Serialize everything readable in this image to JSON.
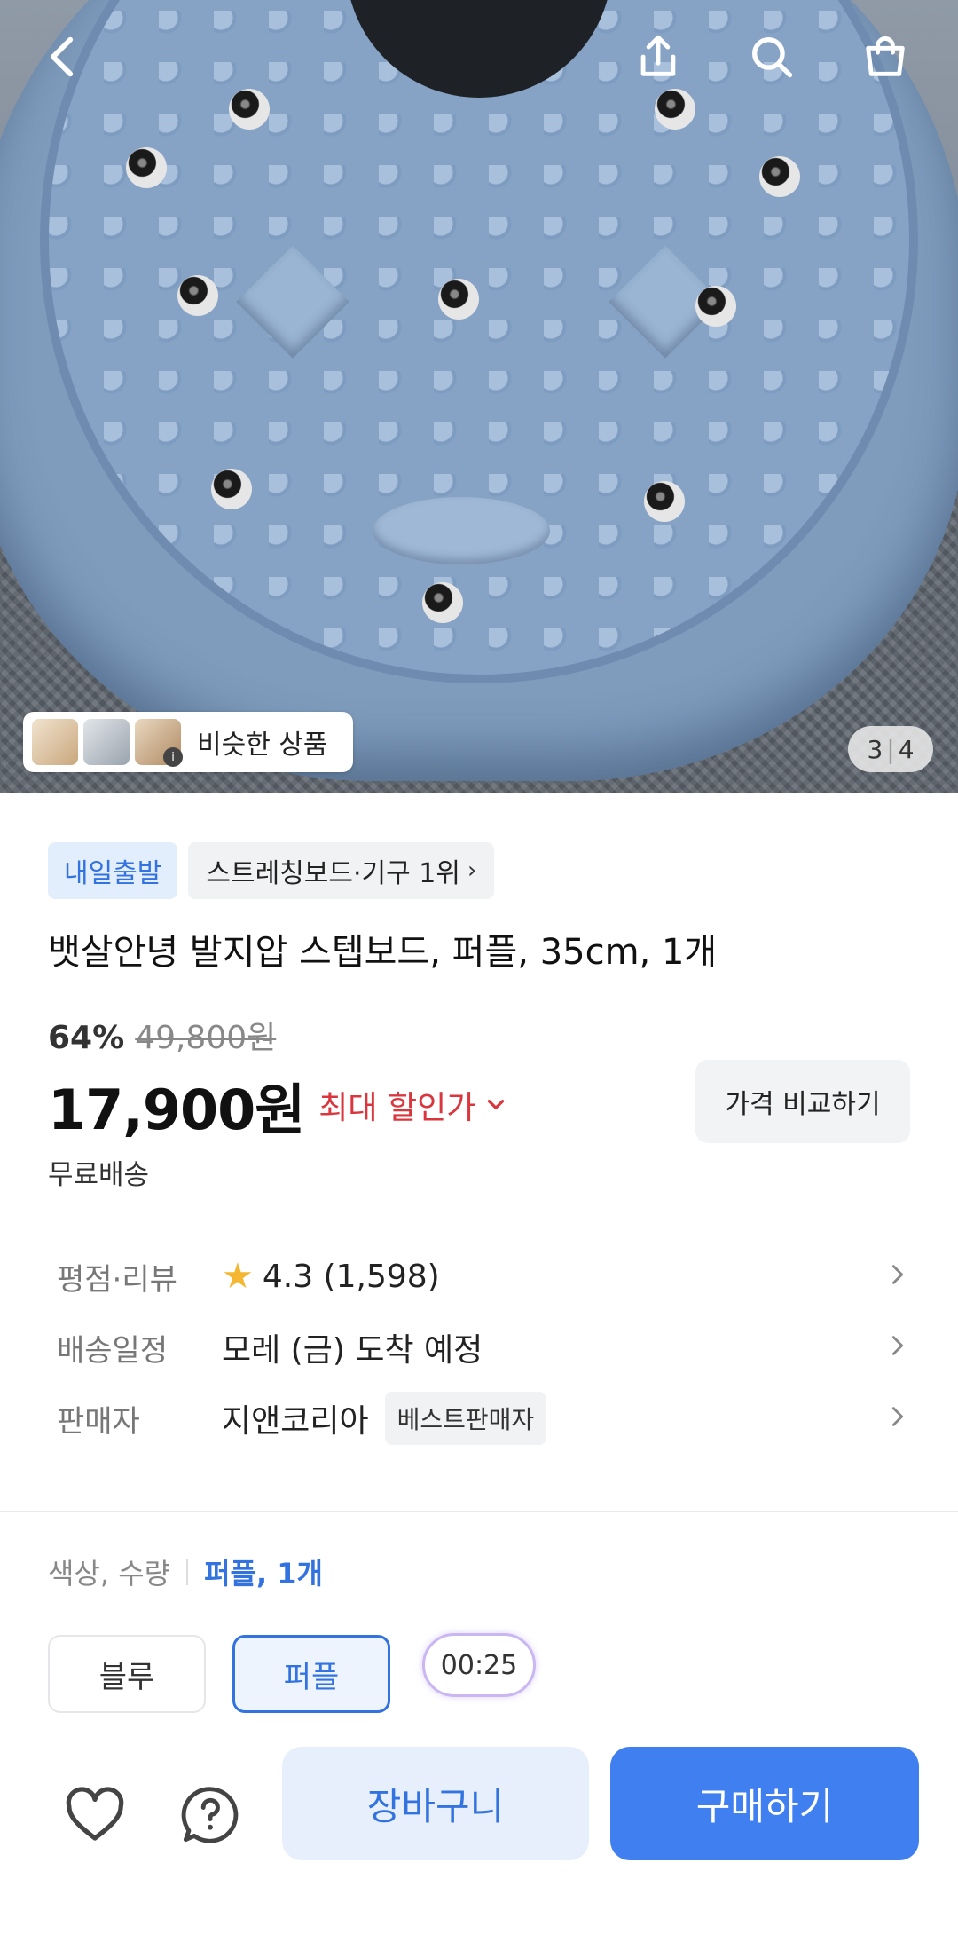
{
  "hero": {
    "similar_label": "비슷한 상품",
    "page_current": "3",
    "page_total": "4",
    "icons": [
      "back-icon",
      "share-icon",
      "search-icon",
      "shopping-bag-icon"
    ]
  },
  "tags": {
    "delivery": "내일출발",
    "ranking": "스트레칭보드·기구 1위"
  },
  "product": {
    "title": "뱃살안녕 발지압 스텝보드, 퍼플, 35cm, 1개",
    "discount_pct": "64%",
    "original_price": "49,800원",
    "price": "17,900원",
    "max_discount_label": "최대 할인가",
    "compare_label": "가격 비교하기",
    "shipping": "무료배송"
  },
  "info": {
    "rating_label": "평점·리뷰",
    "rating_value": "4.3 (1,598)",
    "delivery_label": "배송일정",
    "delivery_value": "모레 (금) 도착 예정",
    "seller_label": "판매자",
    "seller_value": "지앤코리아",
    "seller_badge": "베스트판매자"
  },
  "options": {
    "header_label": "색상, 수량",
    "header_selected": "퍼플, 1개",
    "choices": [
      "블루",
      "퍼플"
    ],
    "timer": "00:25"
  },
  "actions": {
    "cart": "장바구니",
    "buy": "구매하기"
  },
  "colors": {
    "accent": "#3373e0",
    "buy_button": "#3f7ff0",
    "sale_red": "#d9363e",
    "star": "#f5b731"
  }
}
